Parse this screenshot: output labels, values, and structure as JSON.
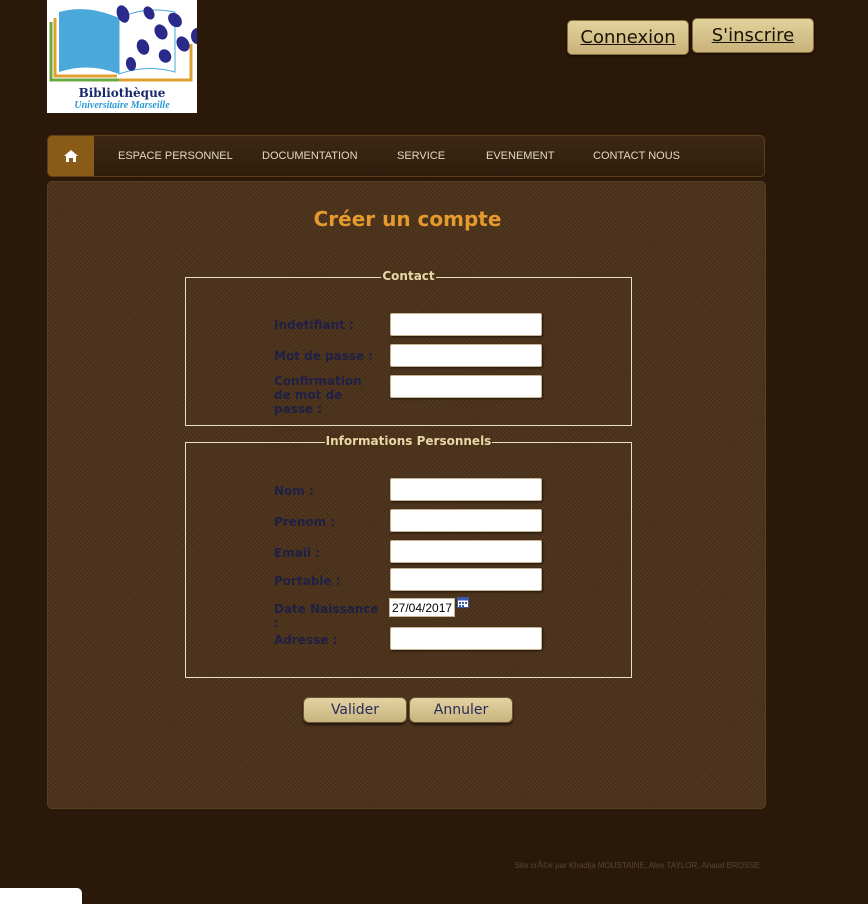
{
  "logo": {
    "title": "Bibliothèque",
    "subtitle": "Universitaire Marseille"
  },
  "header": {
    "login_label": "Connexion",
    "signup_label": "S'inscrire"
  },
  "nav": {
    "home_icon": "home-icon",
    "items": [
      {
        "label": "ESPACE PERSONNEL"
      },
      {
        "label": "DOCUMENTATION"
      },
      {
        "label": "SERVICE"
      },
      {
        "label": "EVENEMENT"
      },
      {
        "label": "CONTACT NOUS"
      }
    ]
  },
  "form": {
    "title": "Créer un compte",
    "contact": {
      "legend": "Contact",
      "identifiant_label": "Indetifiant :",
      "password_label": "Mot de passe :",
      "confirm_label": "Confirmation de mot de passe :"
    },
    "personal": {
      "legend": "Informations Personnels",
      "nom_label": "Nom :",
      "prenom_label": "Prenom :",
      "email_label": "Email :",
      "portable_label": "Portable :",
      "date_label": "Date Naissance :",
      "date_value": "27/04/2017",
      "adresse_label": "Adresse :"
    },
    "submit_label": "Valider",
    "cancel_label": "Annuler"
  },
  "footer": {
    "credits": "Site crÃ©e par Khadija MOUSTAINE, Alex TAYLOR, Anaud BROSSE"
  },
  "colors": {
    "background": "#2a1809",
    "panel": "#4c321a",
    "title": "#e49a2c",
    "button": "#d8c48e",
    "label": "#1f2046"
  }
}
